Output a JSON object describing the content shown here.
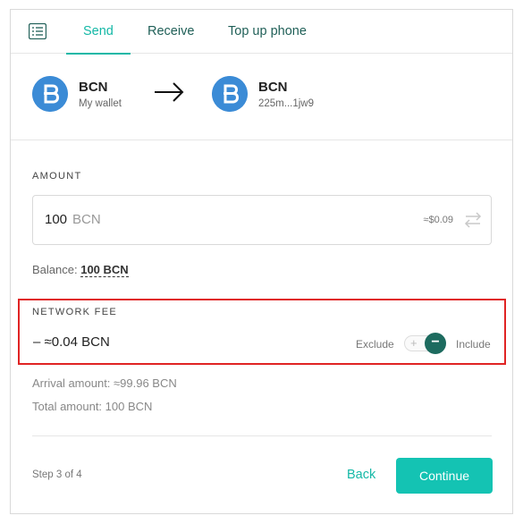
{
  "tabs": [
    {
      "label": "Send",
      "active": true
    },
    {
      "label": "Receive",
      "active": false
    },
    {
      "label": "Top up phone",
      "active": false
    }
  ],
  "from": {
    "coin": "BCN",
    "subtitle": "My wallet",
    "icon": "bytecoin-icon"
  },
  "to": {
    "coin": "BCN",
    "subtitle": "225m...1jw9",
    "icon": "bytecoin-icon"
  },
  "amount": {
    "label": "AMOUNT",
    "value": "100",
    "unit": "BCN",
    "usd": "≈$0.09"
  },
  "balance": {
    "prefix": "Balance:",
    "value": "100 BCN"
  },
  "network_fee": {
    "label": "NETWORK FEE",
    "value": "– ≈0.04 BCN",
    "exclude_label": "Exclude",
    "include_label": "Include",
    "toggle_plus": "+",
    "toggle_minus": "−",
    "state": "include"
  },
  "arrival_amount": "Arrival amount: ≈99.96 BCN",
  "total_amount": "Total amount: 100 BCN",
  "footer": {
    "step": "Step 3 of 4",
    "back_label": "Back",
    "continue_label": "Continue"
  },
  "colors": {
    "accent": "#14b8a6",
    "accent_dark": "#1d6b5f",
    "coin_blue": "#3b8bd6",
    "highlight_red": "#e02424"
  }
}
